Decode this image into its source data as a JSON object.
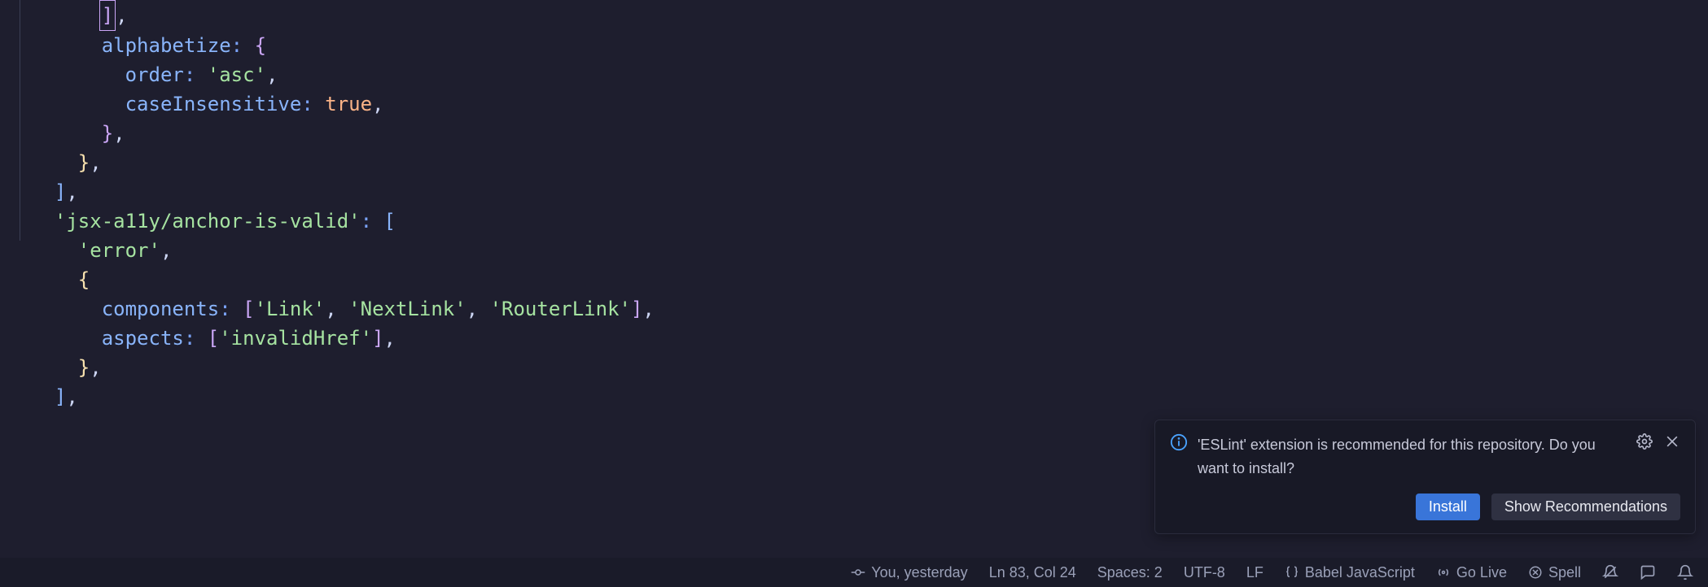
{
  "code": {
    "l1_bracket": "]",
    "l1_comma": ",",
    "l2_key": "alphabetize",
    "l2_brace": "{",
    "l3_key": "order",
    "l3_val": "'asc'",
    "l4_key": "caseInsensitive",
    "l4_val": "true",
    "l5_brace": "}",
    "l6_brace": "}",
    "l7_bracket": "]",
    "l8_key": "'jsx-a11y/anchor-is-valid'",
    "l8_bracket": "[",
    "l9_val": "'error'",
    "l10_brace": "{",
    "l11_key": "components",
    "l11_v1": "'Link'",
    "l11_v2": "'NextLink'",
    "l11_v3": "'RouterLink'",
    "l12_key": "aspects",
    "l12_v1": "'invalidHref'",
    "l13_brace": "}",
    "l14_bracket": "]"
  },
  "notif": {
    "message": "'ESLint' extension is recommended for this repository. Do you want to install?",
    "install": "Install",
    "show": "Show Recommendations"
  },
  "status": {
    "blame": "You, yesterday",
    "cursor": "Ln 83, Col 24",
    "spaces": "Spaces: 2",
    "encoding": "UTF-8",
    "eol": "LF",
    "lang": "Babel JavaScript",
    "golive": "Go Live",
    "spell": "Spell"
  }
}
